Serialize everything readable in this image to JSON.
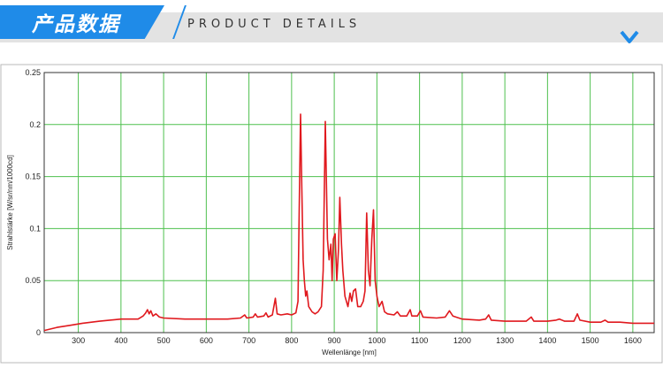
{
  "header": {
    "title_cn": "产品数据",
    "title_en": "PRODUCT DETAILS",
    "accent_color": "#1f8be8",
    "band_color": "#e3e3e3",
    "chevron_icon": "chevron-down-icon"
  },
  "chart_data": {
    "type": "line",
    "xlabel": "Wellenlänge [nm]",
    "ylabel": "Strahlstärke [W/sr/nm/1000cd]",
    "xlim": [
      220,
      1650
    ],
    "ylim": [
      0,
      0.25
    ],
    "xticks": [
      300,
      400,
      500,
      600,
      700,
      800,
      900,
      1000,
      1100,
      1200,
      1300,
      1400,
      1500,
      1600
    ],
    "yticks": [
      "0",
      "0.05",
      "0.1",
      "0.15",
      "0.2",
      "0.25"
    ],
    "ytick_values": [
      0,
      0.05,
      0.1,
      0.15,
      0.2,
      0.25
    ],
    "grid": true,
    "line_color": "#e0191e",
    "grid_color": "#4ec04e",
    "series": [
      {
        "values": [
          [
            220,
            0.002
          ],
          [
            250,
            0.005
          ],
          [
            280,
            0.007
          ],
          [
            310,
            0.009
          ],
          [
            350,
            0.011
          ],
          [
            400,
            0.013
          ],
          [
            440,
            0.013
          ],
          [
            452,
            0.016
          ],
          [
            458,
            0.019
          ],
          [
            462,
            0.022
          ],
          [
            466,
            0.018
          ],
          [
            470,
            0.021
          ],
          [
            475,
            0.016
          ],
          [
            482,
            0.018
          ],
          [
            490,
            0.015
          ],
          [
            500,
            0.014
          ],
          [
            550,
            0.013
          ],
          [
            600,
            0.013
          ],
          [
            650,
            0.013
          ],
          [
            680,
            0.014
          ],
          [
            690,
            0.017
          ],
          [
            695,
            0.014
          ],
          [
            710,
            0.015
          ],
          [
            715,
            0.018
          ],
          [
            720,
            0.015
          ],
          [
            735,
            0.016
          ],
          [
            740,
            0.019
          ],
          [
            745,
            0.015
          ],
          [
            755,
            0.017
          ],
          [
            762,
            0.033
          ],
          [
            766,
            0.018
          ],
          [
            775,
            0.017
          ],
          [
            790,
            0.018
          ],
          [
            800,
            0.017
          ],
          [
            810,
            0.019
          ],
          [
            815,
            0.03
          ],
          [
            818,
            0.12
          ],
          [
            821,
            0.21
          ],
          [
            824,
            0.14
          ],
          [
            827,
            0.07
          ],
          [
            830,
            0.05
          ],
          [
            833,
            0.035
          ],
          [
            836,
            0.04
          ],
          [
            840,
            0.025
          ],
          [
            848,
            0.02
          ],
          [
            855,
            0.018
          ],
          [
            862,
            0.02
          ],
          [
            870,
            0.025
          ],
          [
            874,
            0.06
          ],
          [
            879,
            0.203
          ],
          [
            884,
            0.09
          ],
          [
            888,
            0.07
          ],
          [
            892,
            0.085
          ],
          [
            895,
            0.05
          ],
          [
            898,
            0.09
          ],
          [
            902,
            0.095
          ],
          [
            906,
            0.05
          ],
          [
            910,
            0.08
          ],
          [
            913,
            0.13
          ],
          [
            917,
            0.085
          ],
          [
            920,
            0.06
          ],
          [
            925,
            0.035
          ],
          [
            932,
            0.025
          ],
          [
            937,
            0.038
          ],
          [
            941,
            0.03
          ],
          [
            945,
            0.04
          ],
          [
            950,
            0.042
          ],
          [
            955,
            0.025
          ],
          [
            962,
            0.025
          ],
          [
            968,
            0.03
          ],
          [
            972,
            0.04
          ],
          [
            976,
            0.115
          ],
          [
            980,
            0.06
          ],
          [
            984,
            0.045
          ],
          [
            988,
            0.09
          ],
          [
            992,
            0.118
          ],
          [
            996,
            0.05
          ],
          [
            1000,
            0.035
          ],
          [
            1005,
            0.025
          ],
          [
            1012,
            0.03
          ],
          [
            1018,
            0.02
          ],
          [
            1025,
            0.018
          ],
          [
            1040,
            0.017
          ],
          [
            1048,
            0.02
          ],
          [
            1055,
            0.016
          ],
          [
            1070,
            0.016
          ],
          [
            1078,
            0.022
          ],
          [
            1082,
            0.016
          ],
          [
            1095,
            0.016
          ],
          [
            1102,
            0.021
          ],
          [
            1108,
            0.015
          ],
          [
            1140,
            0.014
          ],
          [
            1160,
            0.015
          ],
          [
            1170,
            0.021
          ],
          [
            1178,
            0.016
          ],
          [
            1200,
            0.013
          ],
          [
            1240,
            0.012
          ],
          [
            1255,
            0.013
          ],
          [
            1262,
            0.017
          ],
          [
            1268,
            0.012
          ],
          [
            1300,
            0.011
          ],
          [
            1350,
            0.011
          ],
          [
            1362,
            0.015
          ],
          [
            1368,
            0.011
          ],
          [
            1400,
            0.011
          ],
          [
            1420,
            0.012
          ],
          [
            1428,
            0.013
          ],
          [
            1440,
            0.011
          ],
          [
            1462,
            0.011
          ],
          [
            1470,
            0.018
          ],
          [
            1476,
            0.012
          ],
          [
            1500,
            0.01
          ],
          [
            1525,
            0.01
          ],
          [
            1535,
            0.012
          ],
          [
            1542,
            0.01
          ],
          [
            1570,
            0.01
          ],
          [
            1600,
            0.009
          ],
          [
            1625,
            0.009
          ],
          [
            1650,
            0.009
          ]
        ]
      }
    ]
  }
}
